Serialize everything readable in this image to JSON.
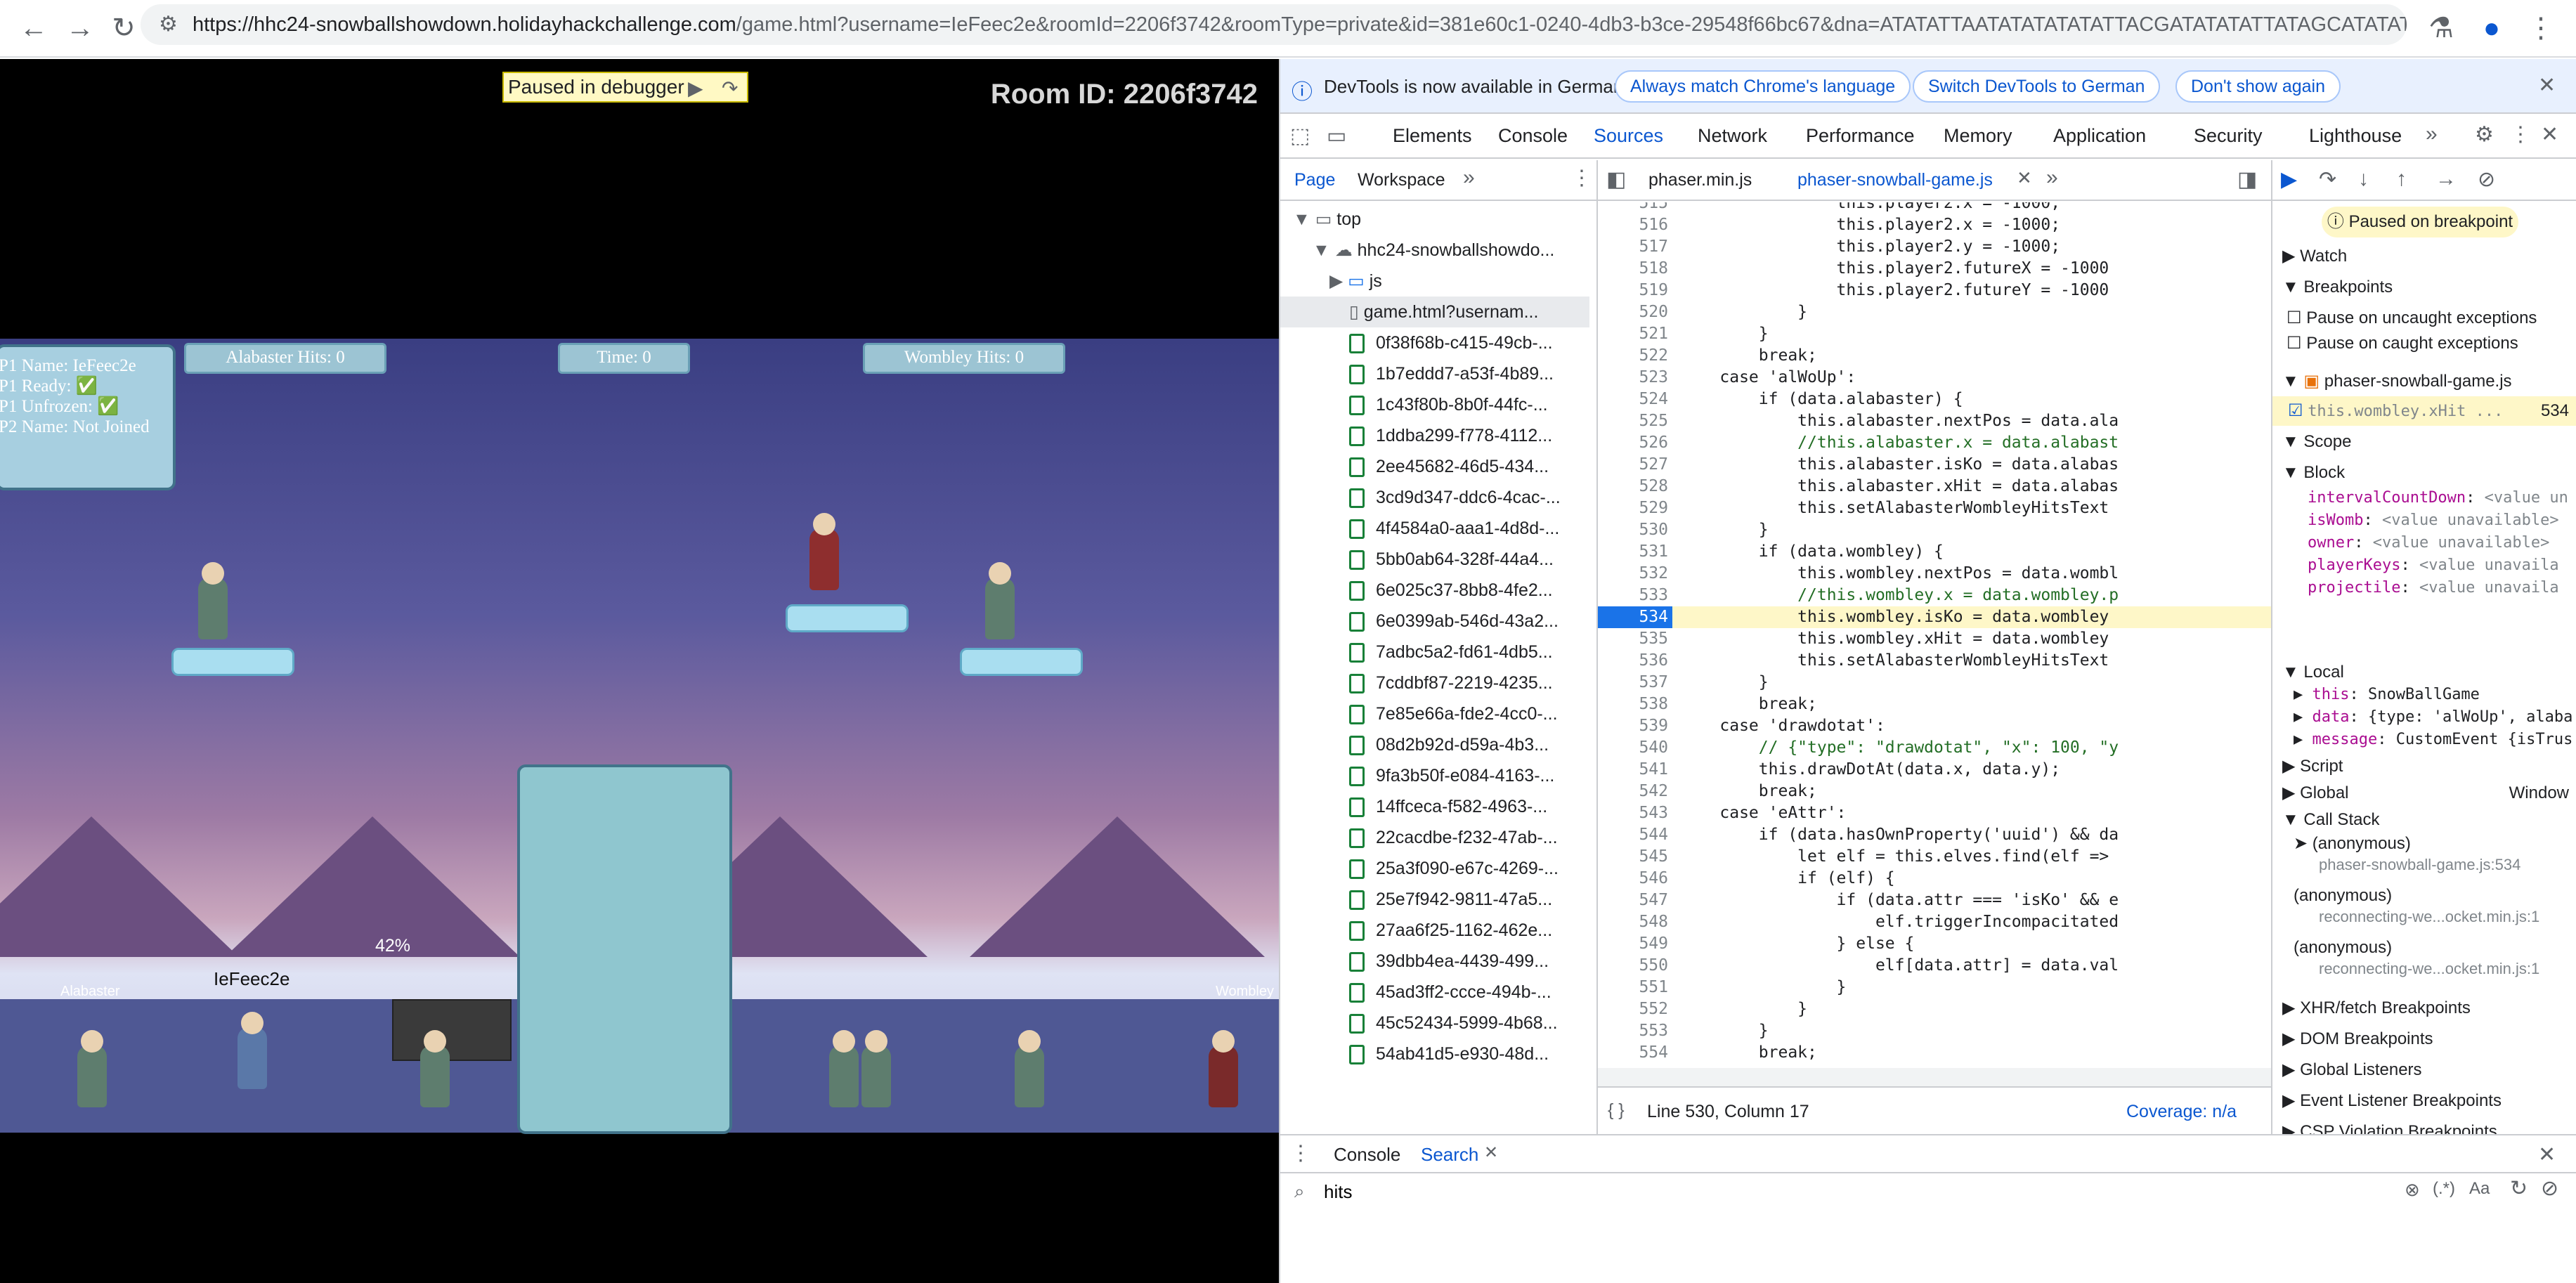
{
  "browser": {
    "url_host": "https://hhc24-snowballshowdown.holidayhackchallenge.com",
    "url_rest": "/game.html?username=IeFeec2e&roomId=2206f3742&roomType=private&id=381e60c1-0240-4db3-b3ce-29548f66bc67&dna=ATATATTAATATATATATATTACGATATATATTATAGCATATATAT..."
  },
  "game": {
    "paused": "Paused in debugger",
    "room": "Room ID: 2206f3742",
    "status": [
      "P1 Name: IeFeec2e",
      "P1 Ready: ✅",
      "P1 Unfrozen: ✅",
      "P2 Name: Not Joined"
    ],
    "alabaster_hits": "Alabaster Hits: 0",
    "time": "Time: 0",
    "wombley_hits": "Wombley Hits: 0",
    "percent": "42%",
    "player": "IeFeec2e",
    "left_name": "Alabaster",
    "right_name": "Wombley"
  },
  "devtools": {
    "info": "DevTools is now available in German!",
    "btn1": "Always match Chrome's language",
    "btn2": "Switch DevTools to German",
    "btn3": "Don't show again",
    "tabs": [
      "Elements",
      "Console",
      "Sources",
      "Network",
      "Performance",
      "Memory",
      "Application",
      "Security",
      "Lighthouse"
    ],
    "nav_tabs": [
      "Page",
      "Workspace"
    ],
    "tree": {
      "top": "top",
      "host": "hhc24-snowballshowdo...",
      "js": "js",
      "game": "game.html?usernam..."
    },
    "files": [
      "0f38f68b-c415-49cb-...",
      "1b7eddd7-a53f-4b89...",
      "1c43f80b-8b0f-44fc-...",
      "1ddba299-f778-4112...",
      "2ee45682-46d5-434...",
      "3cd9d347-ddc6-4cac-...",
      "4f4584a0-aaa1-4d8d-...",
      "5bb0ab64-328f-44a4...",
      "6e025c37-8bb8-4fe2...",
      "6e0399ab-546d-43a2...",
      "7adbc5a2-fd61-4db5...",
      "7cddbf87-2219-4235...",
      "7e85e66a-fde2-4cc0-...",
      "08d2b92d-d59a-4b3...",
      "9fa3b50f-e084-4163-...",
      "14ffceca-f582-4963-...",
      "22cacdbe-f232-47ab-...",
      "25a3f090-e67c-4269-...",
      "25e7f942-9811-47a5...",
      "27aa6f25-1162-462e...",
      "39dbb4ea-4439-499...",
      "45ad3ff2-ccce-494b-...",
      "45c52434-5999-4b68...",
      "54ab41d5-e930-48d..."
    ],
    "editor_tabs": [
      "phaser.min.js",
      "phaser-snowball-game.js"
    ],
    "lines": [
      {
        "n": "515",
        "t": "                this.player2.x = -1000;"
      },
      {
        "n": "516",
        "t": "                this.player2.x = -1000;"
      },
      {
        "n": "517",
        "t": "                this.player2.y = -1000;"
      },
      {
        "n": "518",
        "t": "                this.player2.futureX = -1000"
      },
      {
        "n": "519",
        "t": "                this.player2.futureY = -1000"
      },
      {
        "n": "520",
        "t": "            }"
      },
      {
        "n": "521",
        "t": "        }"
      },
      {
        "n": "522",
        "t": "        break;"
      },
      {
        "n": "523",
        "t": "    case 'alWoUp':"
      },
      {
        "n": "524",
        "t": "        if (data.alabaster) {"
      },
      {
        "n": "525",
        "t": "            this.alabaster.nextPos = data.ala"
      },
      {
        "n": "526",
        "t": "            //this.alabaster.x = data.alabast"
      },
      {
        "n": "527",
        "t": "            this.alabaster.isKo = data.alabas"
      },
      {
        "n": "528",
        "t": "            this.alabaster.xHit = data.alabas"
      },
      {
        "n": "529",
        "t": "            this.setAlabasterWombleyHitsText"
      },
      {
        "n": "530",
        "t": "        }"
      },
      {
        "n": "531",
        "t": "        if (data.wombley) {"
      },
      {
        "n": "532",
        "t": "            this.wombley.nextPos = data.wombl"
      },
      {
        "n": "533",
        "t": "            //this.wombley.x = data.wombley.p"
      },
      {
        "n": "534",
        "t": "            this.wombley.isKo = data.wombley"
      },
      {
        "n": "535",
        "t": "            this.wombley.xHit = data.wombley"
      },
      {
        "n": "536",
        "t": "            this.setAlabasterWombleyHitsText"
      },
      {
        "n": "537",
        "t": "        }"
      },
      {
        "n": "538",
        "t": "        break;"
      },
      {
        "n": "539",
        "t": "    case 'drawdotat':"
      },
      {
        "n": "540",
        "t": "        // {\"type\": \"drawdotat\", \"x\": 100, \"y"
      },
      {
        "n": "541",
        "t": "        this.drawDotAt(data.x, data.y);"
      },
      {
        "n": "542",
        "t": "        break;"
      },
      {
        "n": "543",
        "t": "    case 'eAttr':"
      },
      {
        "n": "544",
        "t": "        if (data.hasOwnProperty('uuid') && da"
      },
      {
        "n": "545",
        "t": "            let elf = this.elves.find(elf =>"
      },
      {
        "n": "546",
        "t": "            if (elf) {"
      },
      {
        "n": "547",
        "t": "                if (data.attr === 'isKo' && e"
      },
      {
        "n": "548",
        "t": "                    elf.triggerIncompacitated"
      },
      {
        "n": "549",
        "t": "                } else {"
      },
      {
        "n": "550",
        "t": "                    elf[data.attr] = data.val"
      },
      {
        "n": "551",
        "t": "                }"
      },
      {
        "n": "552",
        "t": "            }"
      },
      {
        "n": "553",
        "t": "        }"
      },
      {
        "n": "554",
        "t": "        break;"
      }
    ],
    "status_line": "Line 530, Column 17",
    "coverage": "Coverage: n/a",
    "sidebar": {
      "paused": "Paused on breakpoint",
      "watch": "Watch",
      "breakpoints": "Breakpoints",
      "pause_uncaught": "Pause on uncaught exceptions",
      "pause_caught": "Pause on caught exceptions",
      "bp_file": "phaser-snowball-game.js",
      "bp_code": "this.wombley.xHit ...",
      "bp_line": "534",
      "scope": "Scope",
      "block": "Block",
      "block_vars": [
        {
          "k": "intervalCountDown",
          "v": "<value un"
        },
        {
          "k": "isWomb",
          "v": "<value unavailable>"
        },
        {
          "k": "owner",
          "v": "<value unavailable>"
        },
        {
          "k": "playerKeys",
          "v": "<value unavaila"
        },
        {
          "k": "projectile",
          "v": "<value unavaila"
        }
      ],
      "local": "Local",
      "this_k": "this",
      "this_v": "SnowBallGame",
      "data_k": "data",
      "data_v": "{type: 'alWoUp', alaba",
      "msg_k": "message",
      "msg_v": "CustomEvent {isTrus",
      "script": "Script",
      "global": "Global",
      "global_v": "Window",
      "callstack": "Call Stack",
      "stack": [
        {
          "fn": "(anonymous)",
          "loc": "phaser-snowball-game.js:534"
        },
        {
          "fn": "(anonymous)",
          "loc": "reconnecting-we...ocket.min.js:1"
        },
        {
          "fn": "(anonymous)",
          "loc": "reconnecting-we...ocket.min.js:1"
        }
      ],
      "more": [
        "XHR/fetch Breakpoints",
        "DOM Breakpoints",
        "Global Listeners",
        "Event Listener Breakpoints",
        "CSP Violation Breakpoints"
      ]
    },
    "drawer": {
      "tab1": "Console",
      "tab2": "Search",
      "query": "hits"
    }
  }
}
